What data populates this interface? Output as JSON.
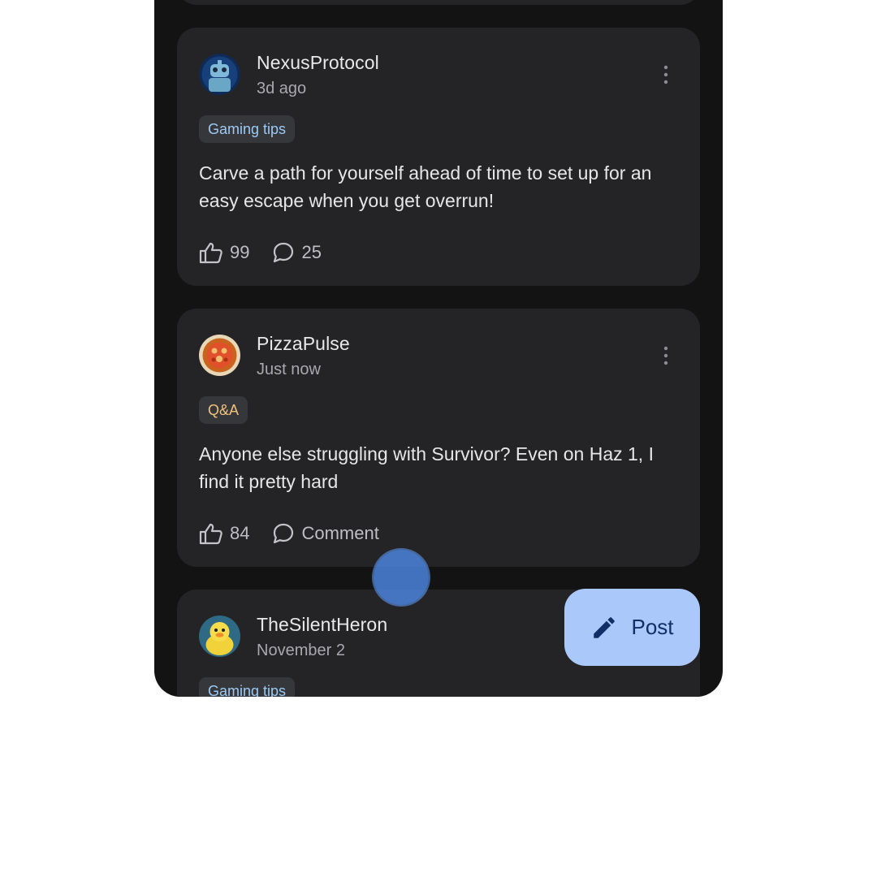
{
  "colors": {
    "background": "#ffffff",
    "phone_bg": "#131314",
    "card_bg": "#242426",
    "tag_tips_text": "#9ccaf5",
    "tag_qa_text": "#f0c27a",
    "fab_bg": "#aac8f9",
    "touch_indicator": "#4b84dc"
  },
  "posts": [
    {
      "author": "NexusProtocol",
      "time": "3d ago",
      "tag": "Gaming tips",
      "text": "Carve a path for yourself ahead of time to set up for an easy escape when you get overrun!",
      "likes": "99",
      "comments": "25",
      "avatar_icon": "robot-avatar"
    },
    {
      "author": "PizzaPulse",
      "time": "Just now",
      "tag": "Q&A",
      "text": "Anyone else struggling with Survivor? Even on Haz 1, I find it pretty hard",
      "likes": "84",
      "comments": "Comment",
      "avatar_icon": "pizza-avatar"
    },
    {
      "author": "TheSilentHeron",
      "time": "November 2",
      "tag": "Gaming tips",
      "avatar_icon": "duck-avatar"
    }
  ],
  "fab": {
    "label": "Post",
    "icon": "pencil-icon"
  }
}
